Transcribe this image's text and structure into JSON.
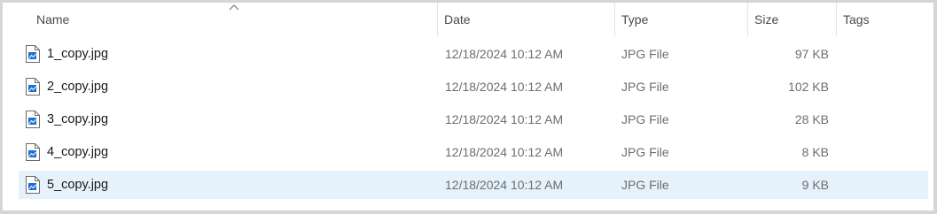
{
  "columns": {
    "name": "Name",
    "date": "Date",
    "type": "Type",
    "size": "Size",
    "tags": "Tags"
  },
  "sort": {
    "column": "name",
    "direction": "ascending",
    "icon": "chevron-up-icon"
  },
  "files": [
    {
      "name": "1_copy.jpg",
      "date": "12/18/2024 10:12 AM",
      "type": "JPG File",
      "size": "97 KB",
      "icon": "image-file-icon",
      "selected": false
    },
    {
      "name": "2_copy.jpg",
      "date": "12/18/2024 10:12 AM",
      "type": "JPG File",
      "size": "102 KB",
      "icon": "image-file-icon",
      "selected": false
    },
    {
      "name": "3_copy.jpg",
      "date": "12/18/2024 10:12 AM",
      "type": "JPG File",
      "size": "28 KB",
      "icon": "image-file-icon",
      "selected": false
    },
    {
      "name": "4_copy.jpg",
      "date": "12/18/2024 10:12 AM",
      "type": "JPG File",
      "size": "8 KB",
      "icon": "image-file-icon",
      "selected": false
    },
    {
      "name": "5_copy.jpg",
      "date": "12/18/2024 10:12 AM",
      "type": "JPG File",
      "size": "9 KB",
      "icon": "image-file-icon",
      "selected": true
    }
  ],
  "colors": {
    "selection": "#e5f1fb",
    "header_text": "#4a4a4a",
    "detail_text": "#6e6e6e",
    "icon_accent": "#1e6fd0"
  }
}
